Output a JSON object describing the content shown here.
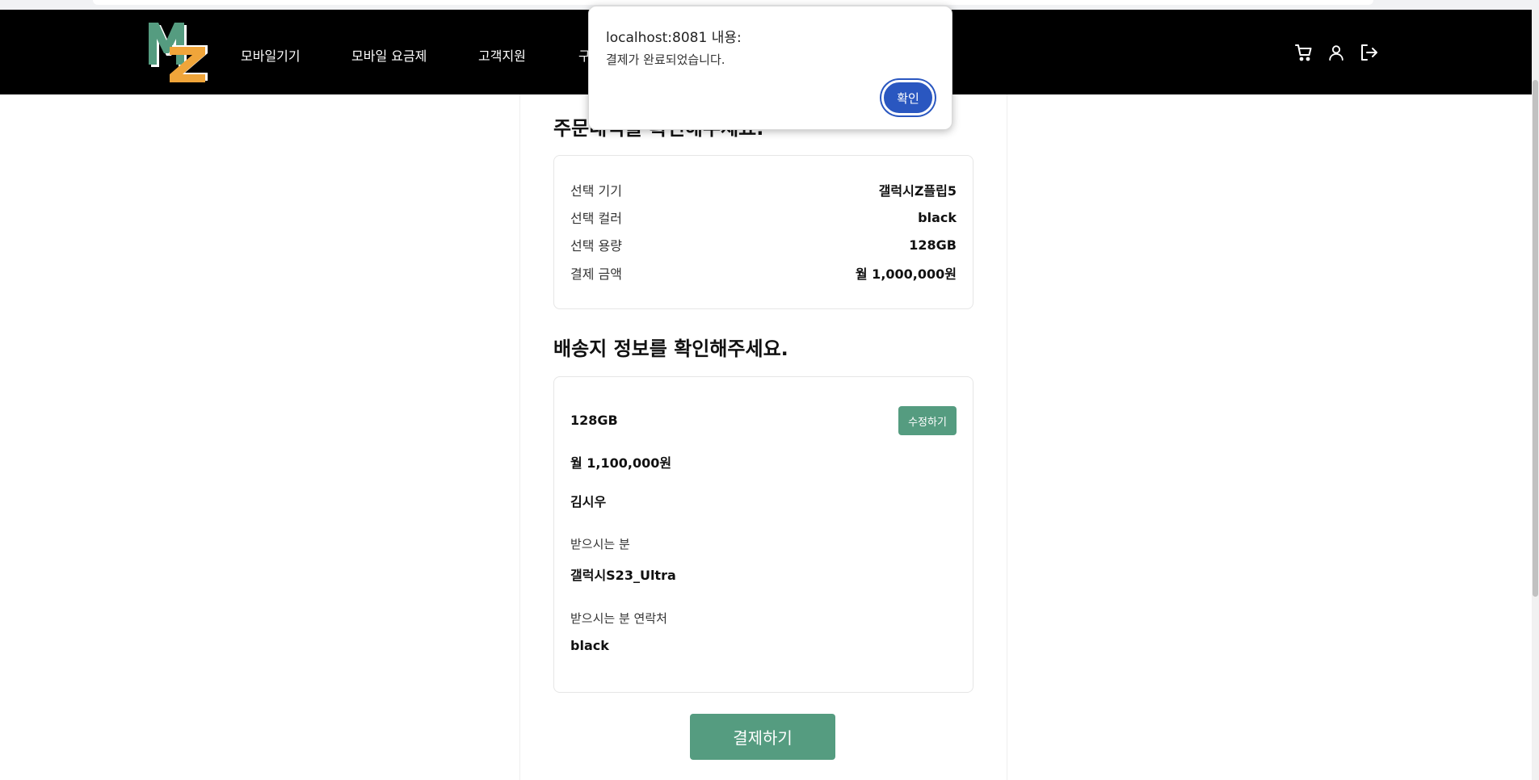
{
  "dialog": {
    "origin": "localhost:8081 내용:",
    "message": "결제가 완료되었습니다.",
    "ok_label": "확인"
  },
  "nav": {
    "items": [
      {
        "label": "모바일기기"
      },
      {
        "label": "모바일 요금제"
      },
      {
        "label": "고객지원"
      },
      {
        "label": "구"
      }
    ],
    "icons": [
      "cart-icon",
      "user-icon",
      "logout-icon"
    ]
  },
  "order": {
    "title": "주문내역을 확인해주세요.",
    "rows": [
      {
        "label": "선택 기기",
        "value": "갤럭시Z플립5"
      },
      {
        "label": "선택 컬러",
        "value": "black"
      },
      {
        "label": "선택 용량",
        "value": "128GB"
      },
      {
        "label": "결제 금액",
        "value": "월 1,000,000원"
      }
    ]
  },
  "shipping": {
    "title": "배송지 정보를 확인해주세요.",
    "edit_label": "수정하기",
    "capacity": "128GB",
    "price": "월 1,100,000원",
    "name": "김시우",
    "recipient_label": "받으시는 분",
    "recipient_value": "갤럭시S23_Ultra",
    "contact_label": "받으시는 분 연락처",
    "contact_value": "black"
  },
  "pay_label": "결제하기",
  "colors": {
    "nav_bg": "#000000",
    "accent_green": "#559c80",
    "dialog_button": "#2a57c0",
    "logo_green": "#559c80",
    "logo_orange": "#f0a53a"
  }
}
